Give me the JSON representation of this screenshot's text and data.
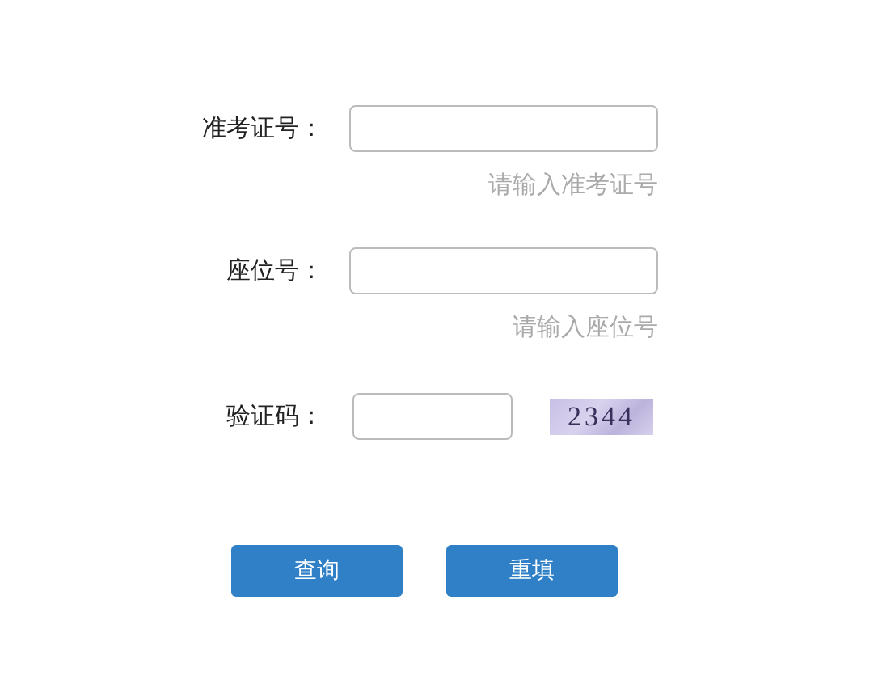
{
  "fields": [
    {
      "kind": "text",
      "label": "准考证号：",
      "hint": "请输入准考证号"
    },
    {
      "kind": "text",
      "label": "座位号：",
      "hint": "请输入座位号"
    },
    {
      "kind": "captcha",
      "label": "验证码：",
      "captcha": "2344"
    }
  ],
  "buttons": [
    "查询",
    "重填"
  ]
}
